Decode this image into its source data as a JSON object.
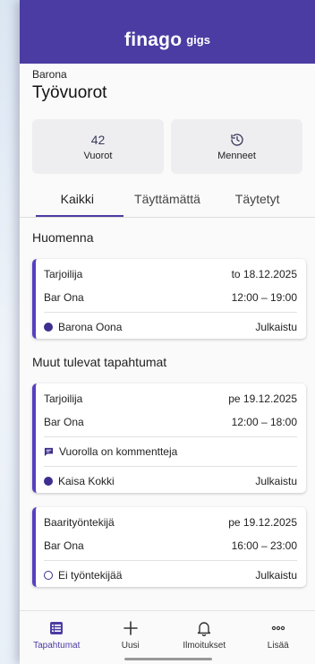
{
  "brand": {
    "name": "finago",
    "sub": "gigs"
  },
  "company": "Barona",
  "page_title": "Työvuorot",
  "stats": [
    {
      "value": "42",
      "label": "Vuorot"
    },
    {
      "label": "Menneet",
      "icon": "history-icon"
    }
  ],
  "tabs": [
    {
      "label": "Kaikki",
      "active": true
    },
    {
      "label": "Täyttämättä"
    },
    {
      "label": "Täytetyt"
    }
  ],
  "sections": [
    {
      "title": "Huomenna",
      "cards": [
        {
          "role": "Tarjoilija",
          "date": "to 18.12.2025",
          "place": "Bar Ona",
          "time": "12:00 – 19:00",
          "worker": "Barona Oona",
          "status": "Julkaistu"
        }
      ]
    },
    {
      "title": "Muut tulevat tapahtumat",
      "cards": [
        {
          "role": "Tarjoilija",
          "date": "pe 19.12.2025",
          "place": "Bar Ona",
          "time": "12:00 – 18:00",
          "comment": "Vuorolla on kommentteja",
          "worker": "Kaisa Kokki",
          "status": "Julkaistu"
        },
        {
          "role": "Baarityöntekijä",
          "date": "pe 19.12.2025",
          "place": "Bar Ona",
          "time": "16:00 – 23:00",
          "worker": "Ei työntekijää",
          "status": "Julkaistu"
        }
      ]
    }
  ],
  "bottom_nav": [
    {
      "label": "Tapahtumat",
      "icon": "list-icon",
      "active": true
    },
    {
      "label": "Uusi",
      "icon": "plus-icon"
    },
    {
      "label": "Ilmoitukset",
      "icon": "bell-icon"
    },
    {
      "label": "Lisää",
      "icon": "more-icon"
    }
  ],
  "colors": {
    "primary": "#4b3ca3",
    "accent": "#5840c0"
  }
}
